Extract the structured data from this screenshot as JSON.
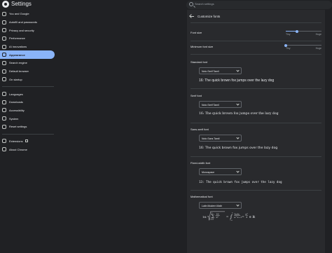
{
  "app": {
    "title": "Settings"
  },
  "search": {
    "placeholder": "Search settings"
  },
  "sidebar": {
    "items": [
      {
        "label": "You and Google",
        "icon": "person-icon"
      },
      {
        "label": "Autofill and passwords",
        "icon": "clipboard-icon"
      },
      {
        "label": "Privacy and security",
        "icon": "shield-icon"
      },
      {
        "label": "Performance",
        "icon": "speedometer-icon"
      },
      {
        "label": "AI innovations",
        "icon": "sparkle-icon"
      },
      {
        "label": "Appearance",
        "icon": "palette-icon",
        "active": true
      },
      {
        "label": "Search engine",
        "icon": "search-icon"
      },
      {
        "label": "Default browser",
        "icon": "browser-icon"
      },
      {
        "label": "On startup",
        "icon": "power-icon"
      }
    ],
    "items2": [
      {
        "label": "Languages",
        "icon": "translate-icon"
      },
      {
        "label": "Downloads",
        "icon": "download-icon"
      },
      {
        "label": "Accessibility",
        "icon": "accessibility-icon"
      },
      {
        "label": "System",
        "icon": "wrench-icon"
      },
      {
        "label": "Reset settings",
        "icon": "reset-icon"
      }
    ],
    "items3": [
      {
        "label": "Extensions",
        "icon": "puzzle-icon"
      },
      {
        "label": "About Chrome",
        "icon": "chrome-icon"
      }
    ]
  },
  "panel": {
    "title": "Customize fonts",
    "font_size": {
      "label": "Font size",
      "min": "Tiny",
      "max": "Huge",
      "value_fraction": 0.32
    },
    "min_font_size": {
      "label": "Minimum font size",
      "min": "Tiny",
      "max": "Huge",
      "value_fraction": 0.0
    },
    "standard": {
      "label": "Standard font",
      "font": "Noto Serif Tamil",
      "sample": "16: The quick brown fox jumps over the lazy dog"
    },
    "serif": {
      "label": "Serif font",
      "font": "Noto Serif Tamil",
      "sample": "16: The quick brown fox jumps over the lazy dog"
    },
    "sans": {
      "label": "Sans-serif font",
      "font": "Noto Sans Tamil",
      "sample": "16: The quick brown fox jumps over the lazy dog"
    },
    "fixed": {
      "label": "Fixed-width font",
      "font": "Monospace",
      "sample": "13: The quick brown fox jumps over the lazy dog"
    },
    "math": {
      "label": "Mathematical font",
      "font": "Latin Modern Math",
      "sample_prefix": "16:"
    }
  },
  "colors": {
    "accent": "#8ab4f8",
    "background": "#202124",
    "panel": "#292a2d"
  }
}
